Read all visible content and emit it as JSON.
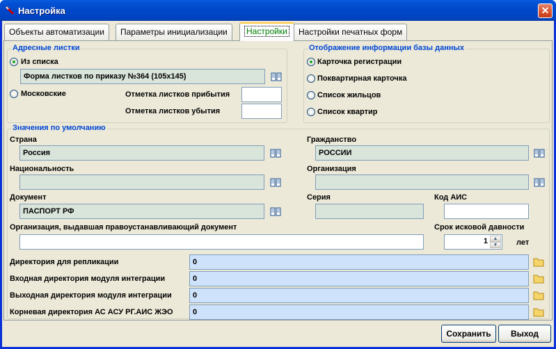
{
  "window": {
    "title": "Настройка",
    "close_label": "✕"
  },
  "tabs": [
    {
      "label": "Объекты автоматизации"
    },
    {
      "label": "Параметры инициализации"
    },
    {
      "label": "Настройки"
    },
    {
      "label": "Настройки печатных форм"
    }
  ],
  "address_group": {
    "title": "Адресные листки",
    "from_list_label": "Из списка",
    "form_value": "Форма листков по приказу №364 (105х145)",
    "moscow_label": "Московские",
    "arrival_label": "Отметка листков прибытия",
    "arrival_value": "",
    "departure_label": "Отметка листков убытия",
    "departure_value": ""
  },
  "display_group": {
    "title": "Отображение информации базы данных",
    "options": [
      {
        "label": "Карточка регистрации",
        "selected": true
      },
      {
        "label": "Поквартирная карточка",
        "selected": false
      },
      {
        "label": "Список жильцов",
        "selected": false
      },
      {
        "label": "Список квартир",
        "selected": false
      }
    ]
  },
  "defaults_group": {
    "title": "Значения по умолчанию",
    "country_label": "Страна",
    "country_value": "Россия",
    "citizenship_label": "Гражданство",
    "citizenship_value": "РОССИИ",
    "nationality_label": "Национальность",
    "nationality_value": "",
    "organization_label": "Организация",
    "organization_value": "",
    "document_label": "Документ",
    "document_value": "ПАСПОРТ РФ",
    "series_label": "Серия",
    "series_value": "",
    "ais_code_label": "Код АИС",
    "ais_code_value": "",
    "issuer_label": "Организация, выдавшая правоустанавливающий документ",
    "issuer_value": "",
    "limitation_label": "Срок исковой давности",
    "limitation_value": "1",
    "limitation_unit": "лет"
  },
  "directories": [
    {
      "label": "Директория для репликации",
      "value": "0"
    },
    {
      "label": "Входная директория модуля интеграции",
      "value": "0"
    },
    {
      "label": "Выходная директория модуля интеграции",
      "value": "0"
    },
    {
      "label": "Корневая директория АС АСУ РГ.АИС ЖЭО",
      "value": "0"
    }
  ],
  "buttons": {
    "save": "Сохранить",
    "exit": "Выход"
  },
  "icons": {
    "book": "book-icon",
    "folder": "folder-icon"
  },
  "colors": {
    "legend": "#0046d5",
    "active_tab_text": "#008000",
    "titlebar": "#0047c8"
  }
}
